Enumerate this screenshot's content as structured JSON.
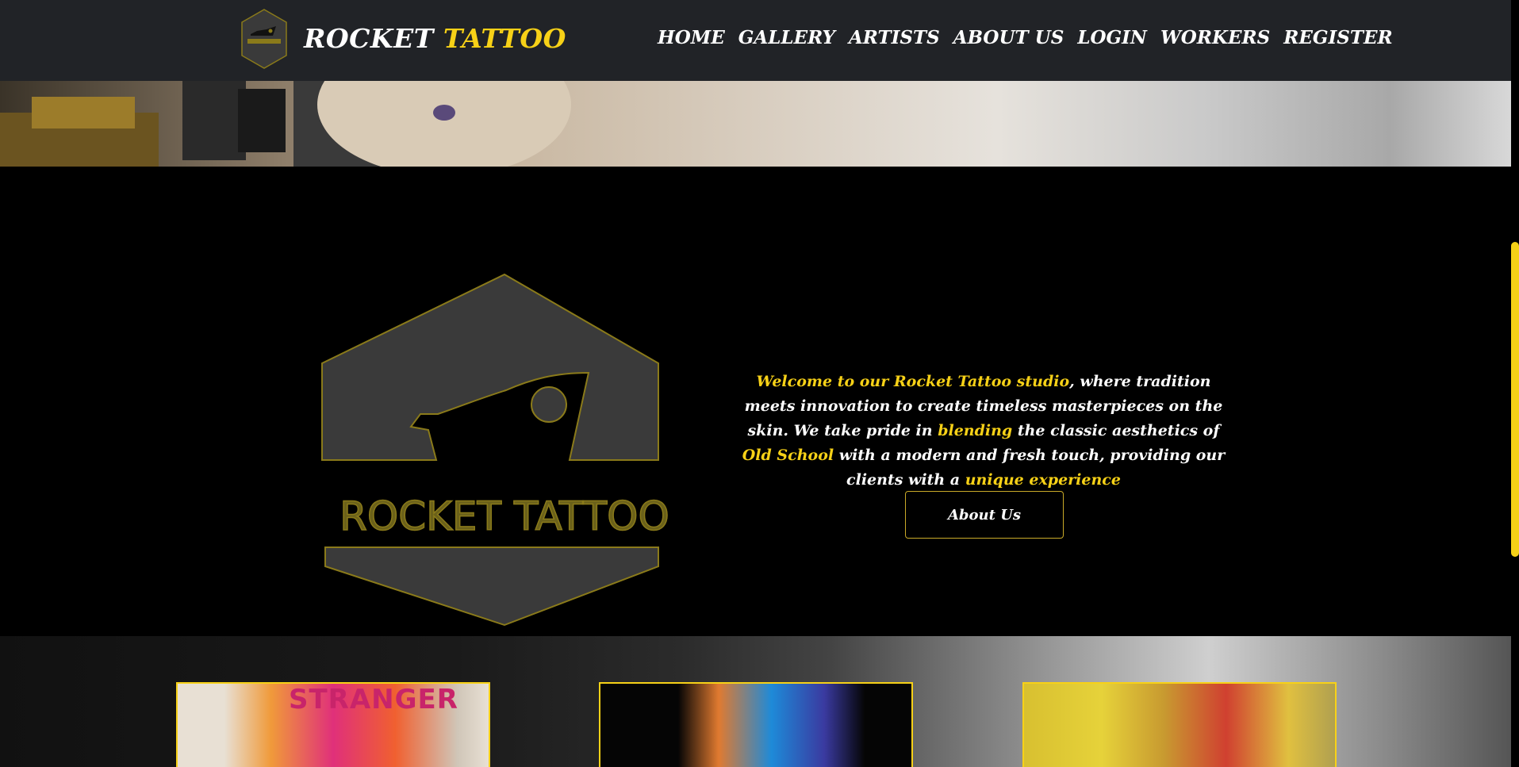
{
  "brand": {
    "name_part1": "ROCKET ",
    "name_part2": "TATTOO"
  },
  "nav": {
    "items": [
      "HOME",
      "GALLERY",
      "ARTISTS",
      "ABOUT US",
      "LOGIN",
      "WORKERS",
      "REGISTER"
    ]
  },
  "about": {
    "logo_text": "ROCKET TATTOO",
    "intro": {
      "s1": "Welcome to our Rocket Tattoo studio",
      "s2": ", where tradition meets innovation to create timeless masterpieces on the skin. We take pride in ",
      "s3": "blending",
      "s4": " the classic aesthetics of ",
      "s5": "Old School",
      "s6": " with a modern and fresh touch, providing our clients with a ",
      "s7": "unique experience"
    },
    "button_label": "About Us"
  },
  "gallery": {
    "card1_text": "STRANGER"
  },
  "colors": {
    "accent": "#f7d117",
    "navbar": "#212327",
    "background": "#000000"
  },
  "icons": [
    "rocket-logo-icon"
  ]
}
